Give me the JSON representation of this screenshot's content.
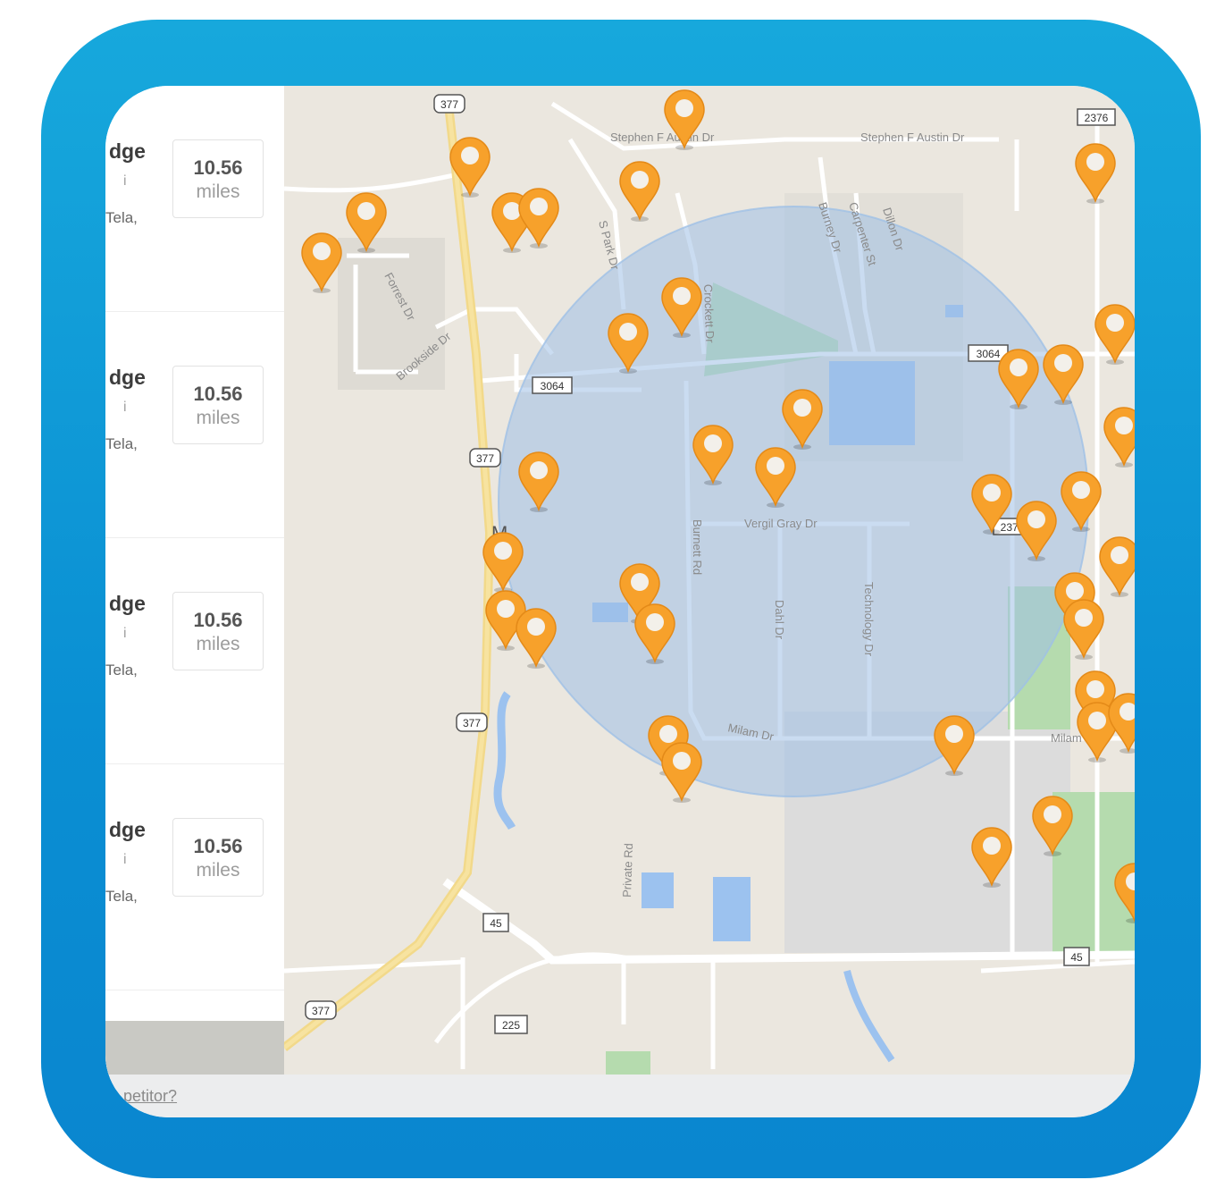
{
  "frame": {
    "accent": "#12a0d8"
  },
  "listing": {
    "cards": [
      {
        "name": "dge",
        "info": "i",
        "address": "Tela,",
        "distance": "10.56",
        "unit": "miles"
      },
      {
        "name": "dge",
        "info": "i",
        "address": "Tela,",
        "distance": "10.56",
        "unit": "miles"
      },
      {
        "name": "dge",
        "info": "i",
        "address": "Tela,",
        "distance": "10.56",
        "unit": "miles"
      },
      {
        "name": "dge",
        "info": "i",
        "address": "Tela,",
        "distance": "10.56",
        "unit": "miles"
      }
    ],
    "footer_link": "petitor?"
  },
  "map": {
    "pin_color": "#f7a12b",
    "radius_color": "#9fc0e6",
    "town_label": "M",
    "roads": {
      "stephen_austin_1": "Stephen F Austin Dr",
      "stephen_austin_2": "Stephen F Austin Dr",
      "s_park": "S Park Dr",
      "crockett": "Crockett Dr",
      "burney": "Burney Dr",
      "carpenter": "Carpenter St",
      "dillon": "Dillon Dr",
      "forrest": "Forrest Dr",
      "brookside": "Brookside Dr",
      "vergil": "Vergil Gray Dr",
      "burnett": "Burnett Rd",
      "dahl": "Dahl Dr",
      "technology": "Technology Dr",
      "milam": "Milam Dr",
      "milam_e": "Milam Dr",
      "private": "Private Rd"
    },
    "shields": {
      "us377_a": "377",
      "us377_b": "377",
      "us377_c": "377",
      "us377_d": "377",
      "fm2376_a": "2376",
      "fm2376_b": "2376",
      "fm3064_a": "3064",
      "fm3064_b": "3064",
      "sh45_a": "45",
      "sh45_b": "45",
      "fm225": "225"
    }
  }
}
